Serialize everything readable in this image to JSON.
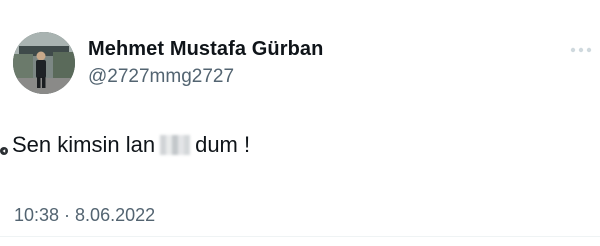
{
  "author": {
    "display_name": "Mehmet Mustafa Gürban",
    "handle": "@2727mmg2727",
    "avatar_icon": "profile-photo"
  },
  "tweet": {
    "text_before": "Sen kimsin lan",
    "text_after": "dum !",
    "censored": true
  },
  "meta": {
    "timestamp": "10:38 · 8.06.2022"
  },
  "icons": {
    "more": "more-dots-icon"
  },
  "colors": {
    "text": "#0f1419",
    "secondary": "#536471",
    "background": "#ffffff"
  }
}
